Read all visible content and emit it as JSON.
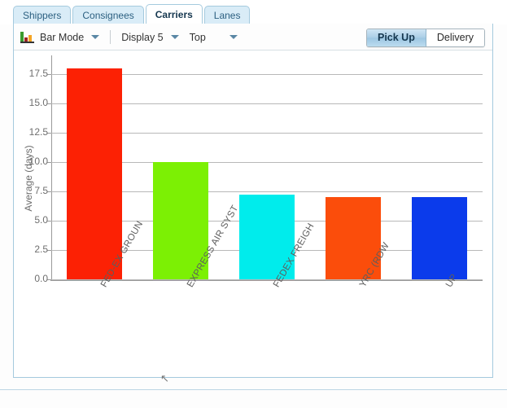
{
  "tabs": [
    {
      "label": "Shippers",
      "active": false
    },
    {
      "label": "Consignees",
      "active": false
    },
    {
      "label": "Carriers",
      "active": true
    },
    {
      "label": "Lanes",
      "active": false
    }
  ],
  "toolbar": {
    "mode_icon": "bar-chart-icon",
    "mode_label": "Bar Mode",
    "display_label": "Display 5",
    "rank_label": "Top",
    "toggle": {
      "pickup_label": "Pick Up",
      "delivery_label": "Delivery",
      "selected": "Pick Up"
    }
  },
  "colors": {
    "tab_active_bg": "#ffffff",
    "tab_inactive_bg": "#d9ecf7",
    "panel_border": "#a5cade",
    "accent": "#2b5f80",
    "grid": "#b8b8b8",
    "axis": "#9a9a9a"
  },
  "chart_data": {
    "type": "bar",
    "title": "",
    "xlabel": "",
    "ylabel": "Average (days)",
    "ylim": [
      0.0,
      18.5
    ],
    "yticks": [
      "0.0",
      "2.5",
      "5.0",
      "7.5",
      "10.0",
      "12.5",
      "15.0",
      "17.5"
    ],
    "ytick_values": [
      0.0,
      2.5,
      5.0,
      7.5,
      10.0,
      12.5,
      15.0,
      17.5
    ],
    "grid": true,
    "legend": "none",
    "categories": [
      "FED-EX  GROUN",
      "EXPRESS  AIR  SYST",
      "FEDEX  FREIGH",
      "YRC  (RDW",
      "UP"
    ],
    "values": [
      18.0,
      10.0,
      7.2,
      7.0,
      7.0
    ],
    "bar_colors": [
      "#fc2104",
      "#7cf004",
      "#00ecec",
      "#fb4d0b",
      "#0b3beb"
    ]
  },
  "cursor": "↖"
}
